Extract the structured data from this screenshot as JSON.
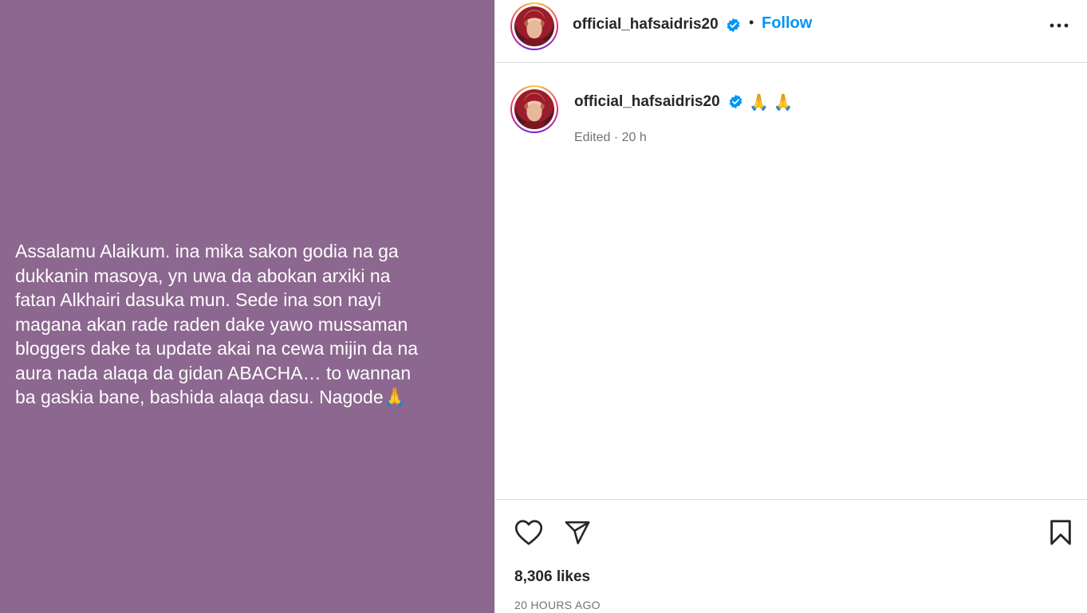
{
  "post": {
    "image_text": "Assalamu Alaikum. ina mika sakon godia na ga\ndukkanin masoya, yn uwa da abokan arxiki na\nfatan Alkhairi dasuka mun. Sede ina son nayi\nmagana akan rade raden dake yawo mussaman\nbloggers dake ta update akai na cewa mijin da na\naura nada alaqa da gidan ABACHA… to wannan\nba gaskia bane, bashida alaqa dasu. Nagode🙏",
    "image_background": "#8c678f"
  },
  "header": {
    "username": "official_hafsaidris20",
    "separator": "•",
    "follow_label": "Follow",
    "more_icon": "more-horizontal-icon"
  },
  "caption": {
    "username": "official_hafsaidris20",
    "text": "🙏🙏",
    "meta": "Edited · 20 h"
  },
  "actions": {
    "like_icon": "heart-icon",
    "share_icon": "send-icon",
    "save_icon": "bookmark-icon"
  },
  "stats": {
    "likes": "8,306 likes",
    "timestamp": "20 HOURS AGO"
  },
  "colors": {
    "accent": "#0095f6",
    "verified": "#0095f6"
  }
}
